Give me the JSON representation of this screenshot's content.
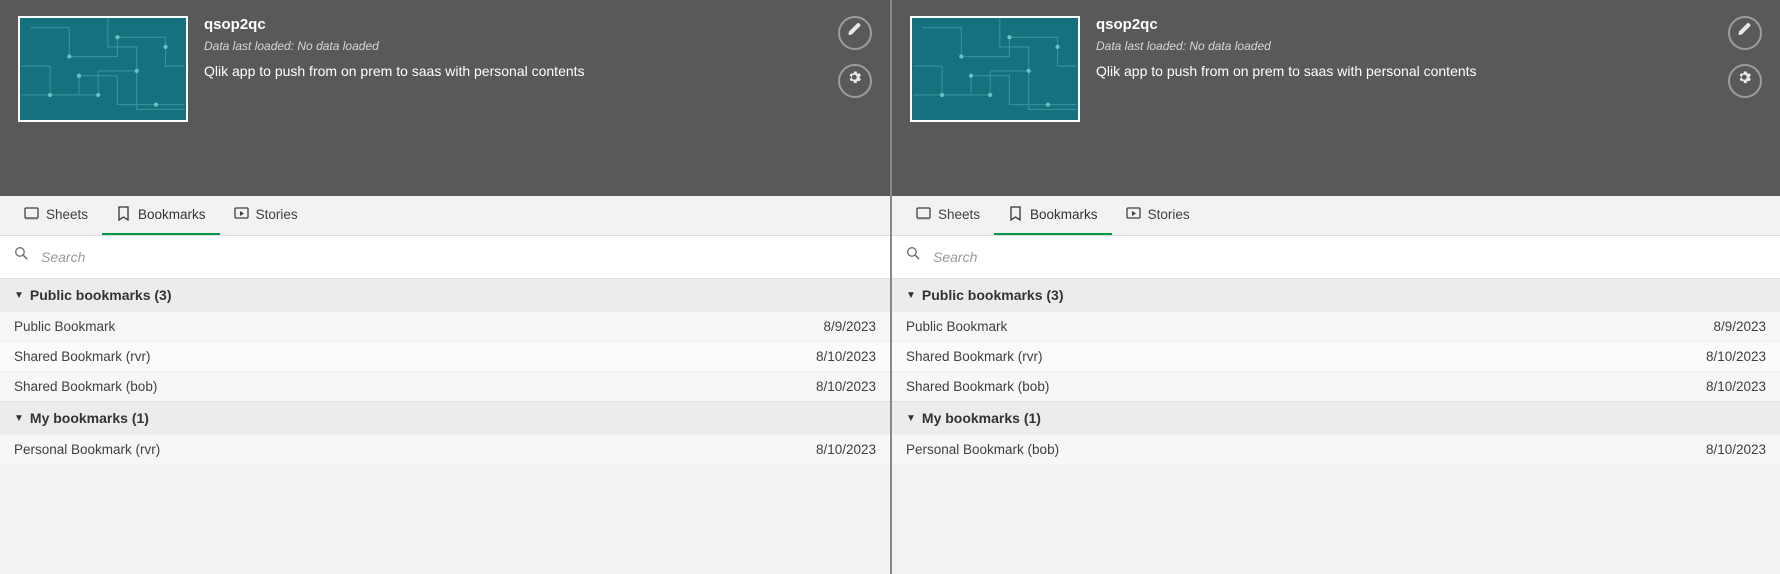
{
  "panes": [
    {
      "app": {
        "title": "qsop2qc",
        "lastLoaded": "Data last loaded: No data loaded",
        "description": "Qlik app to push from on prem to saas with personal contents"
      },
      "tabs": {
        "sheets": "Sheets",
        "bookmarks": "Bookmarks",
        "stories": "Stories"
      },
      "search": {
        "placeholder": "Search"
      },
      "sections": {
        "public": {
          "title": "Public bookmarks (3)",
          "items": [
            {
              "name": "Public Bookmark",
              "date": "8/9/2023"
            },
            {
              "name": "Shared Bookmark (rvr)",
              "date": "8/10/2023"
            },
            {
              "name": "Shared Bookmark (bob)",
              "date": "8/10/2023"
            }
          ]
        },
        "mine": {
          "title": "My bookmarks (1)",
          "items": [
            {
              "name": "Personal Bookmark (rvr)",
              "date": "8/10/2023"
            }
          ]
        }
      }
    },
    {
      "app": {
        "title": "qsop2qc",
        "lastLoaded": "Data last loaded: No data loaded",
        "description": "Qlik app to push from on prem to saas with personal contents"
      },
      "tabs": {
        "sheets": "Sheets",
        "bookmarks": "Bookmarks",
        "stories": "Stories"
      },
      "search": {
        "placeholder": "Search"
      },
      "sections": {
        "public": {
          "title": "Public bookmarks (3)",
          "items": [
            {
              "name": "Public Bookmark",
              "date": "8/9/2023"
            },
            {
              "name": "Shared Bookmark (rvr)",
              "date": "8/10/2023"
            },
            {
              "name": "Shared Bookmark (bob)",
              "date": "8/10/2023"
            }
          ]
        },
        "mine": {
          "title": "My bookmarks (1)",
          "items": [
            {
              "name": "Personal Bookmark (bob)",
              "date": "8/10/2023"
            }
          ]
        }
      }
    }
  ]
}
